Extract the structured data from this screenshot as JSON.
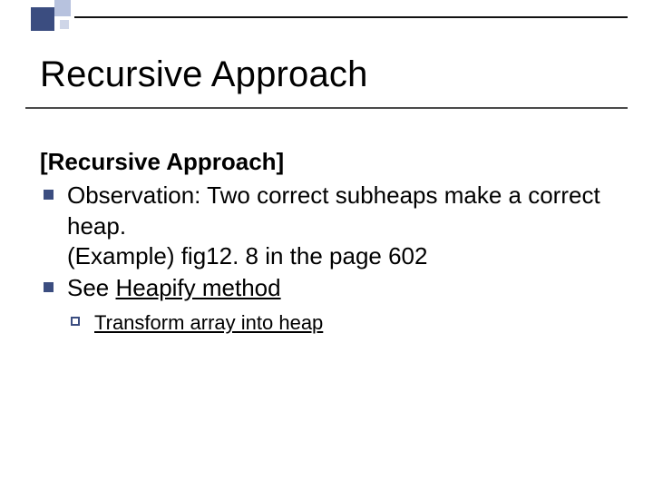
{
  "title": "Recursive Approach",
  "subheader": "[Recursive Approach]",
  "bullets": [
    {
      "text_pre": "Observation: Two correct subheaps make a correct heap.",
      "paren": "(Example) fig12. 8 in the page 602"
    },
    {
      "text_pre": "See ",
      "underlined": "Heapify method"
    }
  ],
  "subbullet": {
    "underlined": "Transform array into heap"
  }
}
